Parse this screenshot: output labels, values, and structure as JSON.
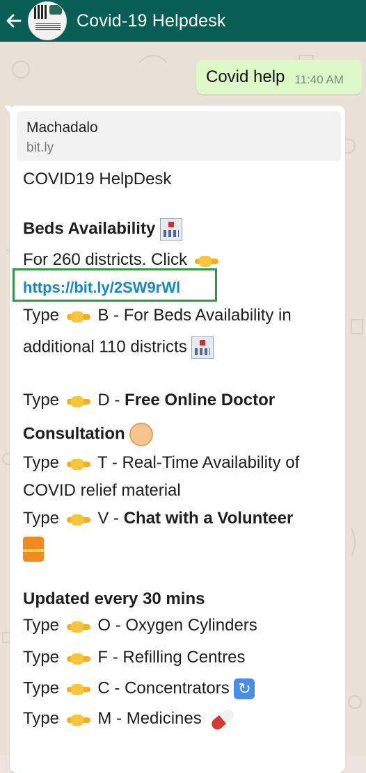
{
  "header": {
    "title": "Covid-19 Helpdesk"
  },
  "outgoing": {
    "text": "Covid help",
    "time": "11:40 AM"
  },
  "incoming": {
    "preview": {
      "site": "Machadalo",
      "domain": "bit.ly"
    },
    "heading": "COVID19 HelpDesk",
    "beds_title": "Beds Availability",
    "for_districts": "For 260 districts. Click",
    "link": "https://bit.ly/2SW9rWl",
    "beds_b_1": "Type",
    "beds_b_2": "B  - For Beds Availability in",
    "beds_b_3": "additional 110 districts",
    "d_1": "Type",
    "d_2": "D -",
    "d_3": "Free Online Doctor",
    "d_4": "Consultation",
    "t_1": "Type",
    "t_2": "T  - Real-Time Availability of",
    "t_3": "COVID relief material",
    "v_1": "Type",
    "v_2": "V -",
    "v_3": "Chat with a Volunteer",
    "updated": "Updated every 30 mins",
    "o_1": "Type",
    "o_2": "O - Oxygen Cylinders",
    "f_1": "Type",
    "f_2": "F -  Refilling Centres",
    "c_1": "Type",
    "c_2": "C - Concentrators",
    "m_1": "Type",
    "m_2": "M - Medicines"
  },
  "colors": {
    "header": "#075e54",
    "outgoing_bubble": "#dcf8c6",
    "link": "#1687c9",
    "highlight_box": "#2e9a49"
  },
  "icons": [
    "back-arrow-icon",
    "avatar",
    "pointing-hand-icon",
    "hospital-icon",
    "doctor-icon",
    "safety-vest-icon",
    "sync-icon",
    "pill-icon"
  ]
}
